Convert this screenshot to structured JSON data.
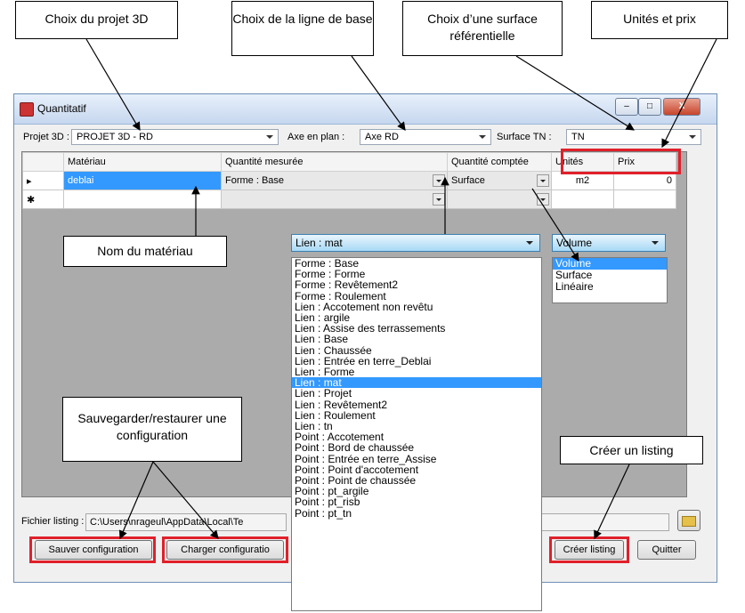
{
  "callouts": {
    "projet": "Choix du projet 3D",
    "ligne": "Choix de la ligne de base",
    "surface": "Choix d’une surface référentielle",
    "unites": "Unités et prix",
    "nom_materiau": "Nom du matériau",
    "sauvegarder": "Sauvegarder/restaurer une configuration",
    "creer": "Créer un listing"
  },
  "window": {
    "title": "Quantitatif",
    "minimize": "–",
    "maximize": "□",
    "close": "X"
  },
  "toolbar": {
    "projet_label": "Projet 3D :",
    "projet_value": "PROJET 3D - RD",
    "axe_label": "Axe en plan :",
    "axe_value": "Axe RD",
    "surface_label": "Surface TN :",
    "surface_value": "TN"
  },
  "grid": {
    "headers": [
      "Matériau",
      "Quantité mesurée",
      "Quantité comptée",
      "Unités",
      "Prix"
    ],
    "rows": [
      {
        "marker": "▸",
        "materiau": "deblai",
        "quantite_mesuree": "Forme : Base",
        "quantite_comptee": "Surface",
        "unites": "m2",
        "prix": "0"
      }
    ],
    "new_row_marker": "✱"
  },
  "lien_dropdown": {
    "selected": "Lien  : mat",
    "options": [
      "Forme : Base",
      "Forme : Forme",
      "Forme : Revêtement2",
      "Forme : Roulement",
      "Lien  : Accotement non revêtu",
      "Lien  : argile",
      "Lien  : Assise des terrassements",
      "Lien  : Base",
      "Lien  : Chaussée",
      "Lien  : Entrée en terre_Deblai",
      "Lien  : Forme",
      "Lien  : mat",
      "Lien  : Projet",
      "Lien  : Revêtement2",
      "Lien  : Roulement",
      "Lien  : tn",
      "Point : Accotement",
      "Point : Bord de chaussée",
      "Point : Entrée en terre_Assise",
      "Point : Point d'accotement",
      "Point : Point de chaussée",
      "Point : pt_argile",
      "Point : pt_risb",
      "Point : pt_tn"
    ],
    "highlighted_index": 11
  },
  "volume_dropdown": {
    "selected": "Volume",
    "options": [
      "Volume",
      "Surface",
      "Linéaire"
    ],
    "highlighted_index": 0
  },
  "footer": {
    "fichier_label": "Fichier listing :",
    "fichier_value": "C:\\Users\\nrageul\\AppData\\Local\\Te",
    "sauver": "Sauver configuration",
    "charger": "Charger configuratio",
    "creer": "Créer listing",
    "quitter": "Quitter",
    "folder_icon": "folder-icon"
  },
  "colors": {
    "highlight": "#3399ff",
    "callout_border": "#e0202a"
  }
}
